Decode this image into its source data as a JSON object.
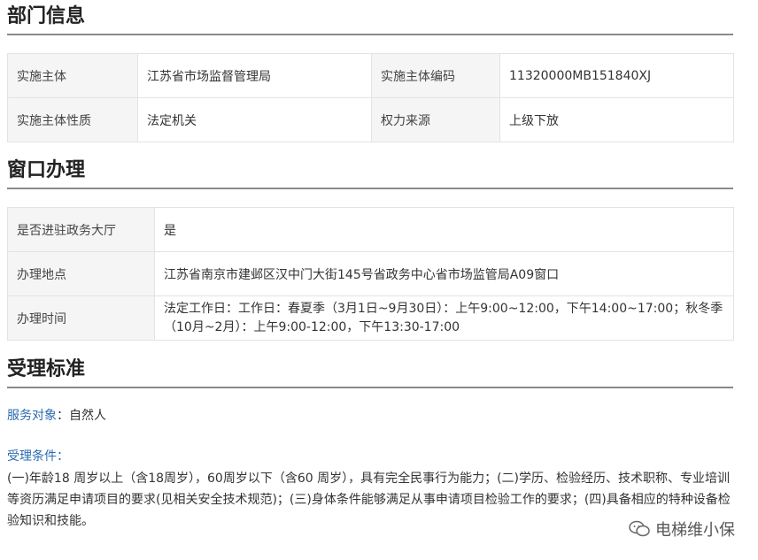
{
  "sections": {
    "dept": {
      "title": "部门信息"
    },
    "window": {
      "title": "窗口办理"
    },
    "accept": {
      "title": "受理标准"
    }
  },
  "dept_table": {
    "rows": [
      {
        "k1": "实施主体",
        "v1": "江苏省市场监督管理局",
        "k2": "实施主体编码",
        "v2": "11320000MB151840XJ"
      },
      {
        "k1": "实施主体性质",
        "v1": "法定机关",
        "k2": "权力来源",
        "v2": "上级下放"
      }
    ]
  },
  "window_table": {
    "rows": [
      {
        "k": "是否进驻政务大厅",
        "v": "是"
      },
      {
        "k": "办理地点",
        "v": "江苏省南京市建邺区汉中门大街145号省政务中心省市场监管局A09窗口"
      },
      {
        "k": "办理时间",
        "v": "法定工作日：工作日：春夏季（3月1日~9月30日）：上午9:00~12:00，下午14:00~17:00；秋冬季（10月~2月）：上午9:00-12:00，下午13:30-17:00"
      }
    ]
  },
  "service": {
    "label": "服务对象",
    "sep": "：",
    "value": "自然人"
  },
  "conditions": {
    "label": "受理条件：",
    "text": "(一)年龄18 周岁以上（含18周岁），60周岁以下（含60 周岁），具有完全民事行为能力；(二)学历、检验经历、技术职称、专业培训等资历满足申请项目的要求(见相关安全技术规范)；(三)身体条件能够满足从事申请项目检验工作的要求；(四)具备相应的特种设备检验知识和技能。"
  },
  "watermark": {
    "text": "电梯维小保",
    "icon": "wechat-icon"
  }
}
